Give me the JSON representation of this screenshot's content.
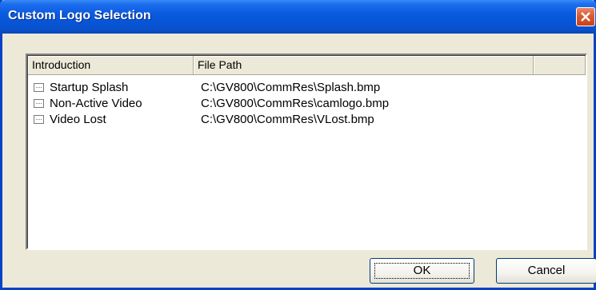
{
  "window": {
    "title": "Custom Logo Selection"
  },
  "icons": {
    "close": "close-icon",
    "tree_leaf": "tree-leaf-box-icon"
  },
  "list": {
    "columns": [
      "Introduction",
      "File Path",
      ""
    ],
    "rows": [
      {
        "introduction": "Startup Splash",
        "file_path": "C:\\GV800\\CommRes\\Splash.bmp"
      },
      {
        "introduction": "Non-Active Video",
        "file_path": "C:\\GV800\\CommRes\\camlogo.bmp"
      },
      {
        "introduction": "Video Lost",
        "file_path": "C:\\GV800\\CommRes\\VLost.bmp"
      }
    ]
  },
  "buttons": {
    "ok": "OK",
    "cancel": "Cancel"
  },
  "colors": {
    "titlebar": "#0754d6",
    "close_button": "#d95b33",
    "dialog_bg": "#ece9d8"
  }
}
